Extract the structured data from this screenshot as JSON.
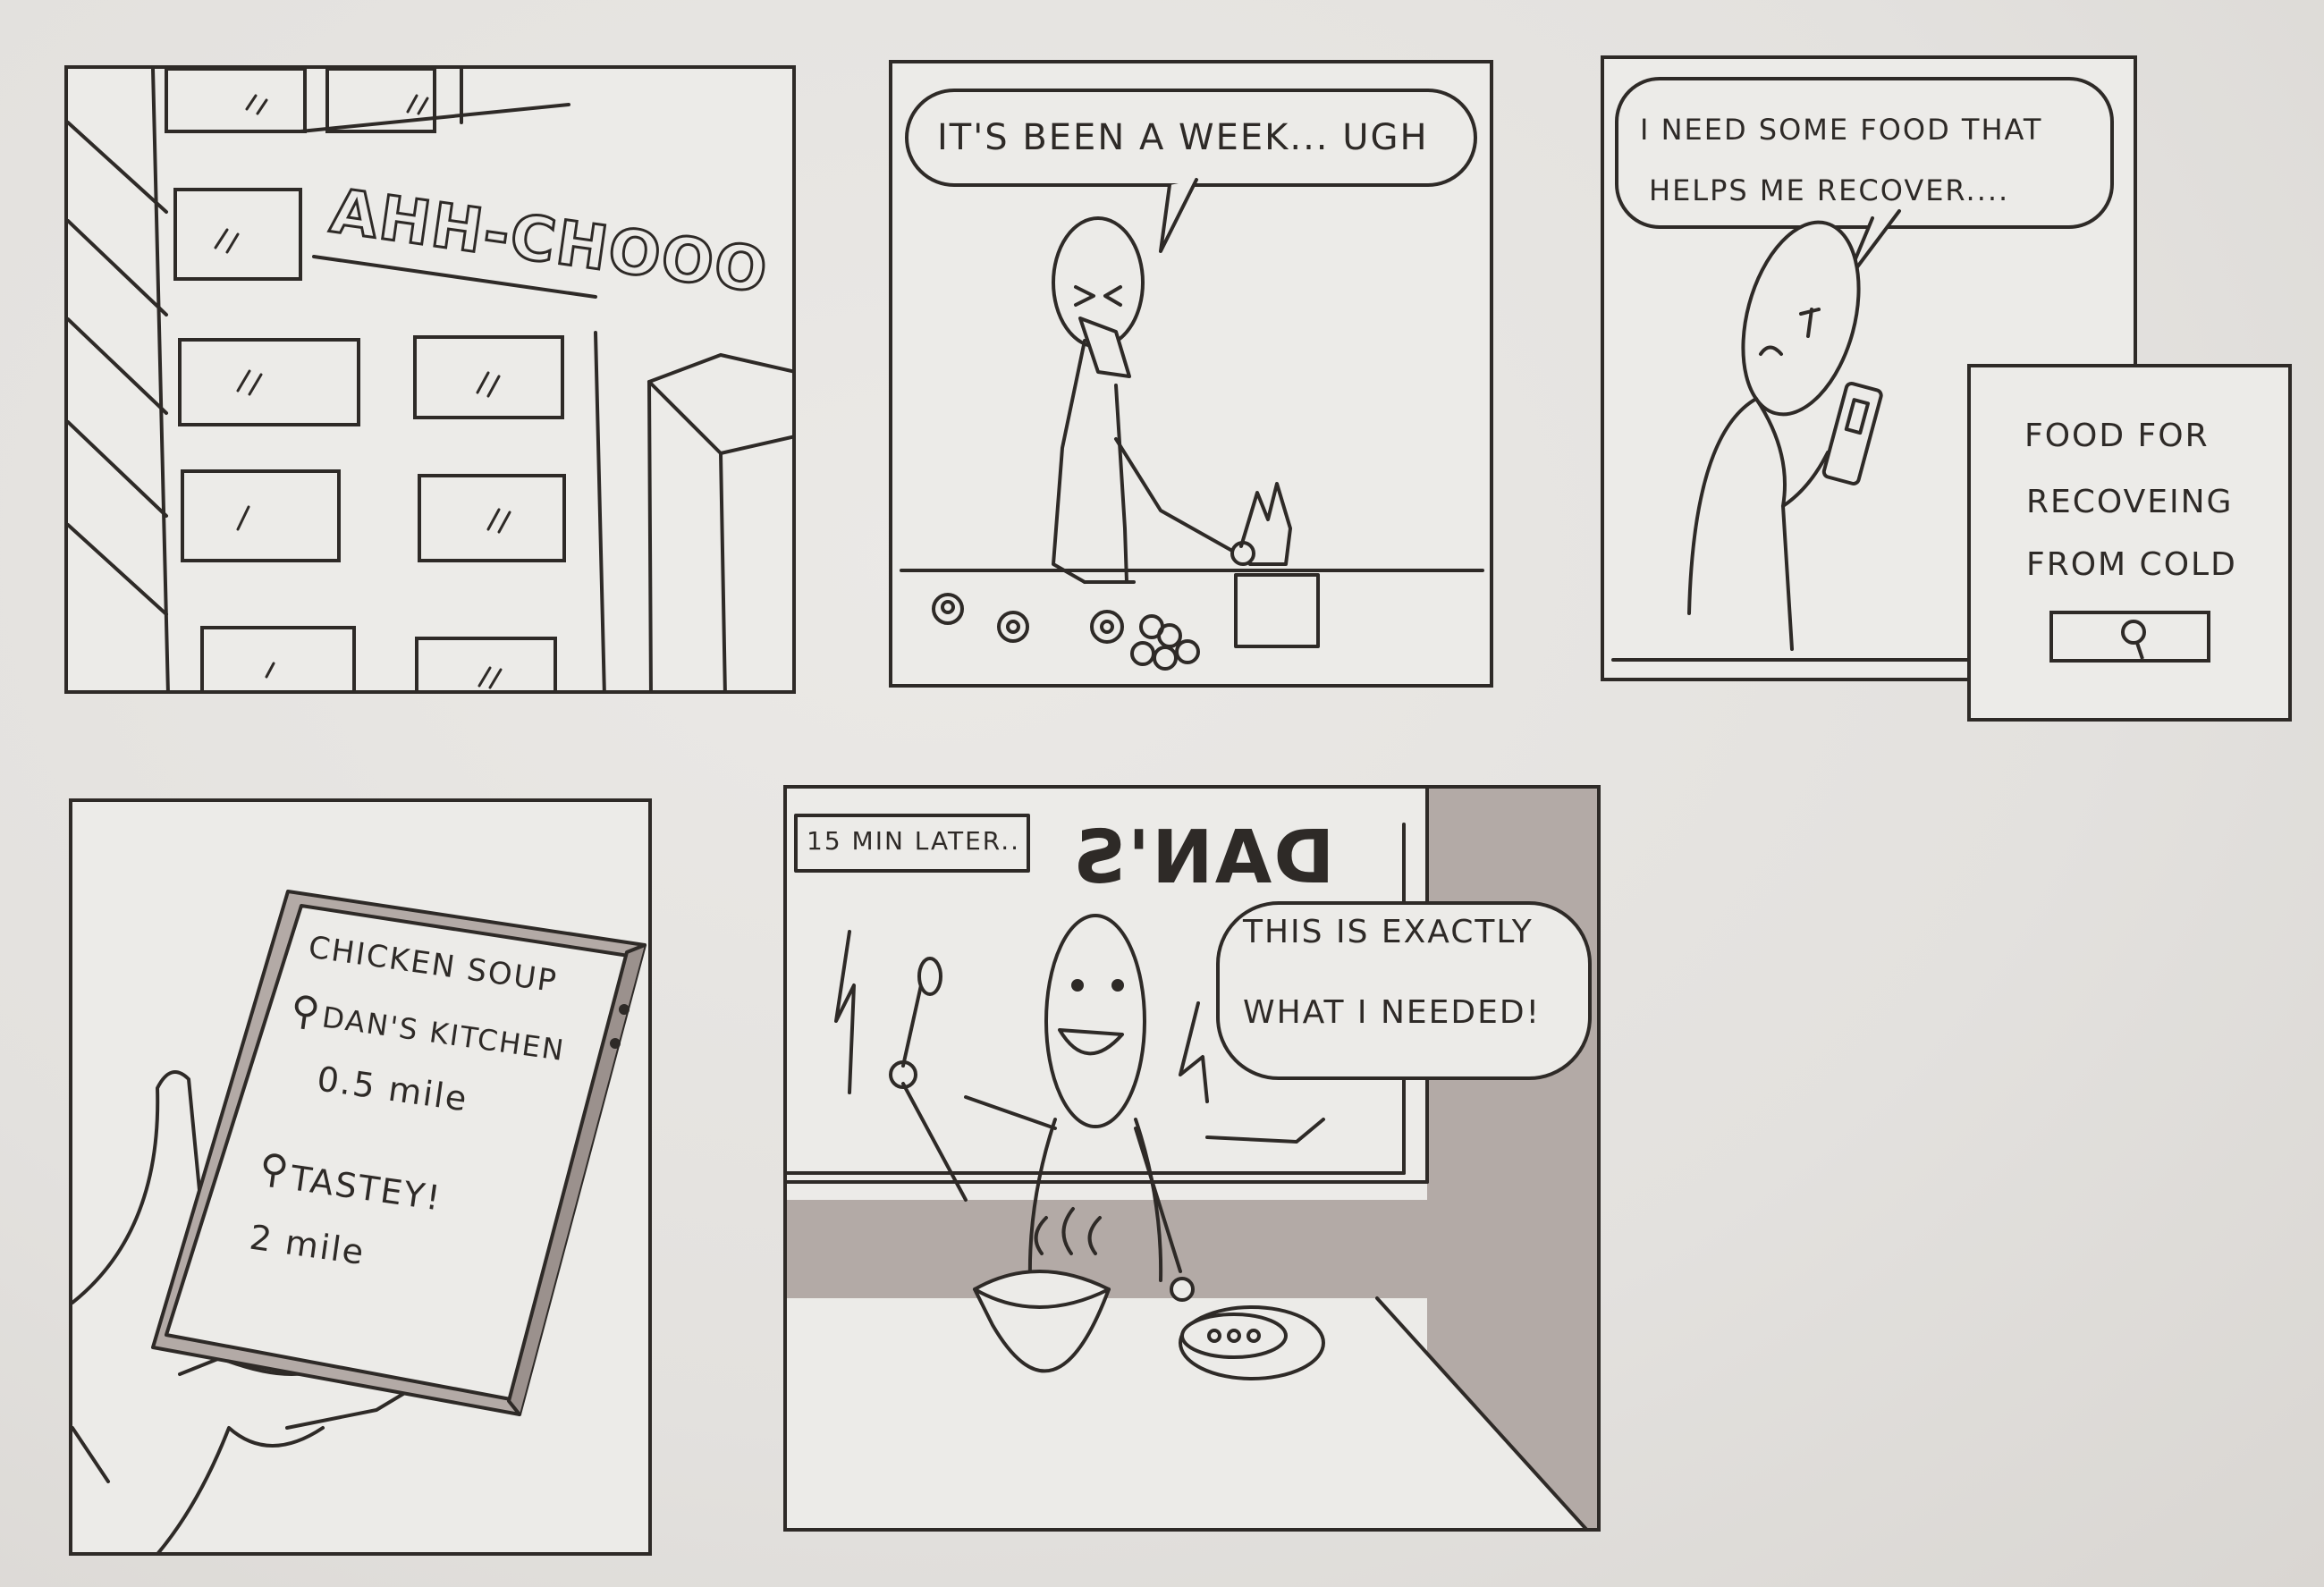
{
  "panel1": {
    "sfx": "AHH-CHOOO"
  },
  "panel2": {
    "speech": "IT'S BEEN A WEEK... UGH"
  },
  "panel3": {
    "speech_line1": "I NEED SOME FOOD THAT",
    "speech_line2": "HELPS ME RECOVER....",
    "search_line1": "FOOD FOR",
    "search_line2": "RECOVEING",
    "search_line3": "FROM COLD",
    "search_icon": "search-icon"
  },
  "panel4": {
    "title": "CHICKEN SOUP",
    "result1_name": "DAN'S KITCHEN",
    "result1_distance": "0.5 mile",
    "result2_name": "TASTEY!",
    "result2_distance": "2 mile",
    "pin_icon": "location-pin-icon"
  },
  "panel5": {
    "caption": "15 MIN LATER..",
    "sign": "DAN'S",
    "speech_line1": "THIS IS EXACTLY",
    "speech_line2": "WHAT I NEEDED!"
  },
  "colors": {
    "ink": "#2e2a27",
    "paper": "#ecebe8",
    "marker": "#b3aaa6"
  }
}
